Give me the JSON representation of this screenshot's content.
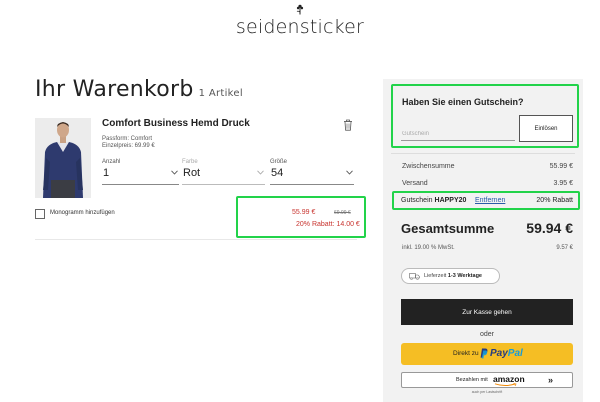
{
  "brand": {
    "name": "seidensticker"
  },
  "cart": {
    "title": "Ihr Warenkorb",
    "count": "1 Artikel"
  },
  "product": {
    "name": "Comfort Business Hemd Druck",
    "fit": "Passform: Comfort",
    "unit_price": "Einzelpreis: 69.99 €",
    "quantity_label": "Anzahl",
    "quantity_value": "1",
    "color_label": "Farbe",
    "color_value": "Rot",
    "size_label": "Größe",
    "size_value": "54",
    "monogram_label": "Monogramm hinzufügen",
    "price_new": "55.99 €",
    "price_old": "69.99 €",
    "discount_text": "20% Rabatt: 14.00 €"
  },
  "coupon": {
    "title": "Haben Sie einen Gutschein?",
    "input_placeholder": "Gutschein",
    "redeem_label": "Einlösen"
  },
  "summary": {
    "subtotal_label": "Zwischensumme",
    "subtotal_value": "55.99 €",
    "shipping_label": "Versand",
    "shipping_value": "3.95 €",
    "voucher_label": "Gutschein",
    "voucher_code": "HAPPY20",
    "voucher_remove": "Entfernen",
    "voucher_discount": "20% Rabatt",
    "total_label": "Gesamtsumme",
    "total_value": "59.94 €",
    "vat_label": "inkl. 19.00 % MwSt.",
    "vat_value": "9.57 €",
    "delivery_prefix": "Lieferzeit",
    "delivery_days": "1-3 Werktage"
  },
  "actions": {
    "checkout_label": "Zur Kasse gehen",
    "or_label": "oder",
    "paypal_prefix": "Direkt zu",
    "paypal_word_a": "Pay",
    "paypal_word_b": "Pal",
    "amazon_prefix": "Bezahlen mit",
    "amazon_word": "amazon",
    "amazon_chevron": "»",
    "amazon_sub": "auch per Lastschrift"
  },
  "colors": {
    "highlight": "#22d34a",
    "sale_red": "#c8342f",
    "paypal_yellow": "#f5be24",
    "checkout_black": "#222222",
    "panel_bg": "#f2f2f2"
  },
  "icons": [
    "flower-logo-icon",
    "trash-icon",
    "chevron-down-icon",
    "truck-icon",
    "paypal-icon",
    "amazon-smile-icon"
  ]
}
